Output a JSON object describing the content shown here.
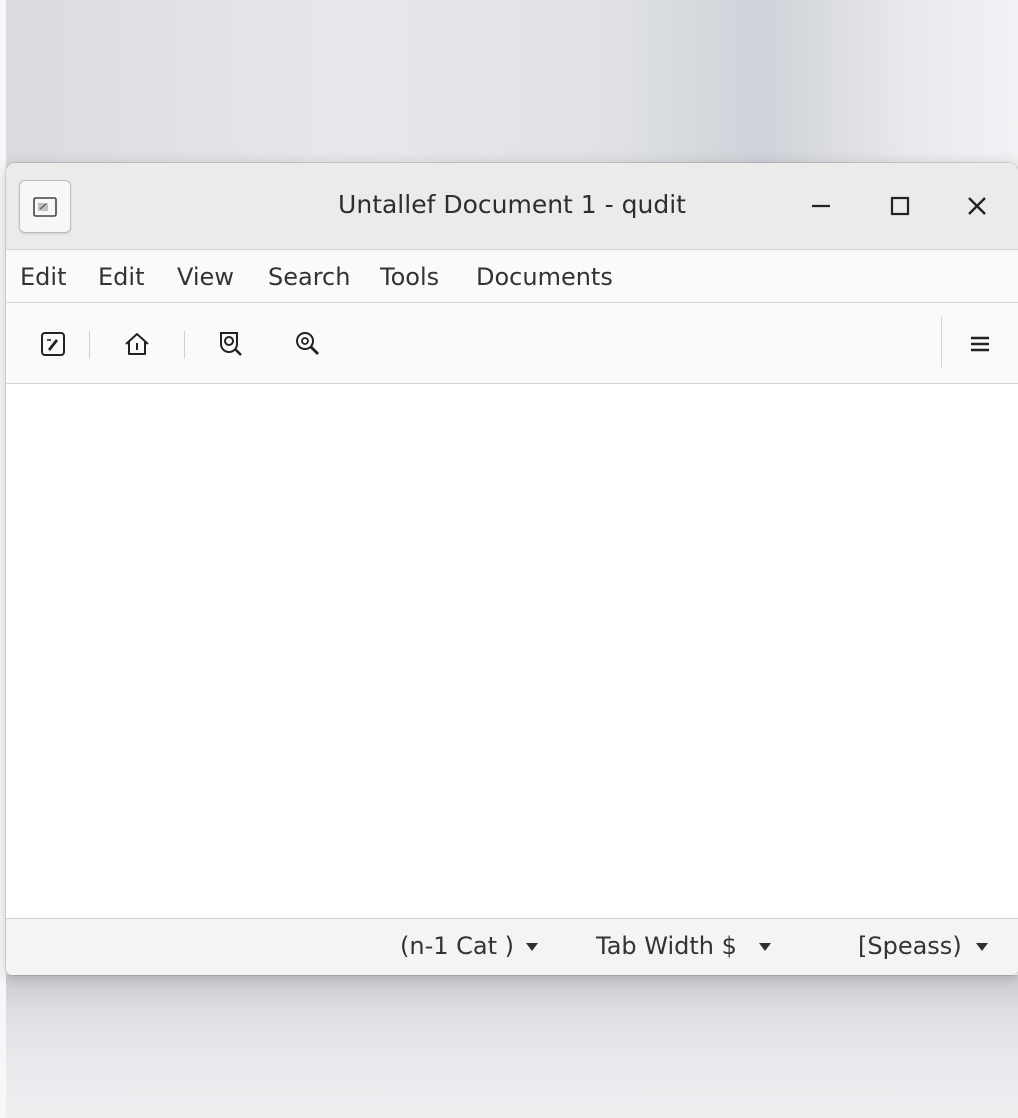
{
  "window": {
    "title": "Untallef Document 1 - qudit"
  },
  "menubar": {
    "items": [
      {
        "label": "Edit"
      },
      {
        "label": "Edit"
      },
      {
        "label": "View"
      },
      {
        "label": "Search"
      },
      {
        "label": "Tools"
      },
      {
        "label": "Documents"
      }
    ]
  },
  "toolbar": {
    "tools": [
      {
        "icon": "edit-document-icon"
      },
      {
        "icon": "home-icon"
      },
      {
        "icon": "find-icon"
      },
      {
        "icon": "zoom-icon"
      }
    ],
    "menu_icon": "hamburger-menu-icon"
  },
  "statusbar": {
    "language": "(n-1 Cat )",
    "tab_width": "Tab Width $",
    "spaces": "[Speass)"
  }
}
